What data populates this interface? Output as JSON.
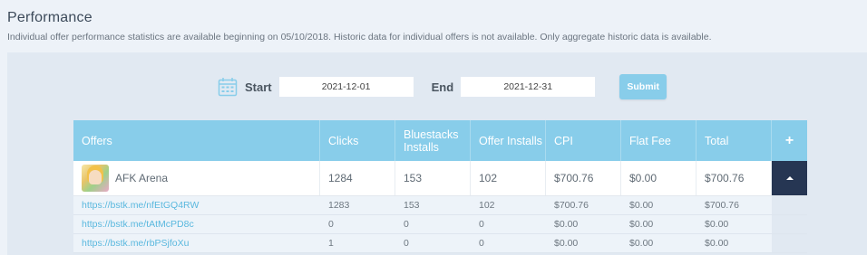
{
  "page": {
    "title": "Performance",
    "subtitle": "Individual offer performance statistics are available beginning on 05/10/2018. Historic data for individual offers is not available. Only aggregate historic data is available."
  },
  "filters": {
    "icon": "calendar-icon",
    "start_label": "Start",
    "start_value": "2021-12-01",
    "end_label": "End",
    "end_value": "2021-12-31",
    "submit_label": "Submit"
  },
  "table": {
    "headers": {
      "offers": "Offers",
      "clicks": "Clicks",
      "bluestacks_installs": "Bluestacks Installs",
      "offer_installs": "Offer Installs",
      "cpi": "CPI",
      "flat_fee": "Flat Fee",
      "total": "Total",
      "expand": "+"
    },
    "main_row": {
      "name": "AFK Arena",
      "clicks": "1284",
      "bluestacks_installs": "153",
      "offer_installs": "102",
      "cpi": "$700.76",
      "flat_fee": "$0.00",
      "total": "$700.76"
    },
    "sub_rows": [
      {
        "link": "https://bstk.me/nfEtGQ4RW",
        "clicks": "1283",
        "bluestacks_installs": "153",
        "offer_installs": "102",
        "cpi": "$700.76",
        "flat_fee": "$0.00",
        "total": "$700.76"
      },
      {
        "link": "https://bstk.me/tAtMcPD8c",
        "clicks": "0",
        "bluestacks_installs": "0",
        "offer_installs": "0",
        "cpi": "$0.00",
        "flat_fee": "$0.00",
        "total": "$0.00"
      },
      {
        "link": "https://bstk.me/rbPSjfoXu",
        "clicks": "1",
        "bluestacks_installs": "0",
        "offer_installs": "0",
        "cpi": "$0.00",
        "flat_fee": "$0.00",
        "total": "$0.00"
      }
    ]
  },
  "colors": {
    "header_bg": "#88cdea",
    "accent_dark": "#263653",
    "link": "#5ab8de",
    "page_bg": "#edf2f8"
  }
}
